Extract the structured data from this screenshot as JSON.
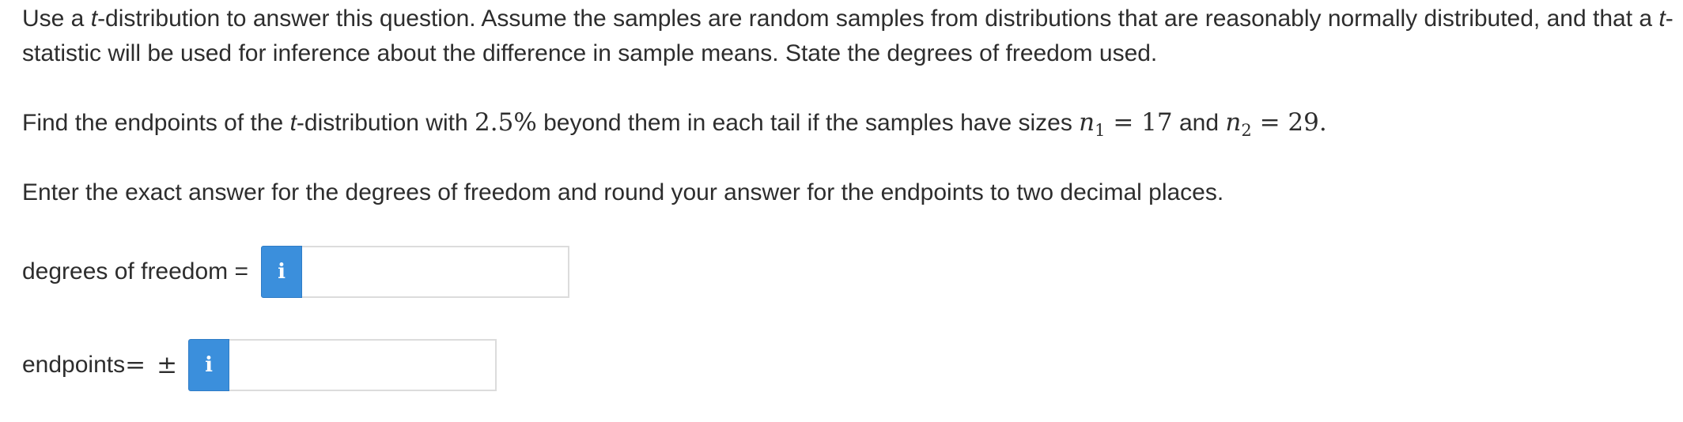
{
  "question": {
    "intro_part1": "Use a ",
    "intro_t1": "t",
    "intro_part2": "-distribution to answer this question. Assume the samples are random samples from distributions that are reasonably normally distributed, and that a ",
    "intro_t2": "t",
    "intro_part3": "-statistic will be used for inference about the difference in sample means. State the degrees of freedom used.",
    "find_part1": "Find the endpoints of the ",
    "find_t": "t",
    "find_part2": "-distribution with ",
    "find_percent": "2.5%",
    "find_part3": " beyond them in each tail if the samples have sizes ",
    "n1_var": "n",
    "n1_sub": "1",
    "n1_eq": " = 17",
    "find_and": " and ",
    "n2_var": "n",
    "n2_sub": "2",
    "n2_eq": " = 29.",
    "instructions": "Enter the exact answer for the degrees of freedom and round your answer for the endpoints to two decimal places."
  },
  "fields": {
    "dof_label": "degrees of freedom =",
    "dof_value": "",
    "endpoints_label": "endpoints",
    "endpoints_eq": " =",
    "endpoints_pm": "±",
    "endpoints_value": "",
    "info_glyph": "i"
  },
  "colors": {
    "info_button": "#3b8fdc",
    "text": "#2d2d2d",
    "input_border": "#dcdcdc"
  },
  "icons": {
    "info": "info-icon"
  }
}
